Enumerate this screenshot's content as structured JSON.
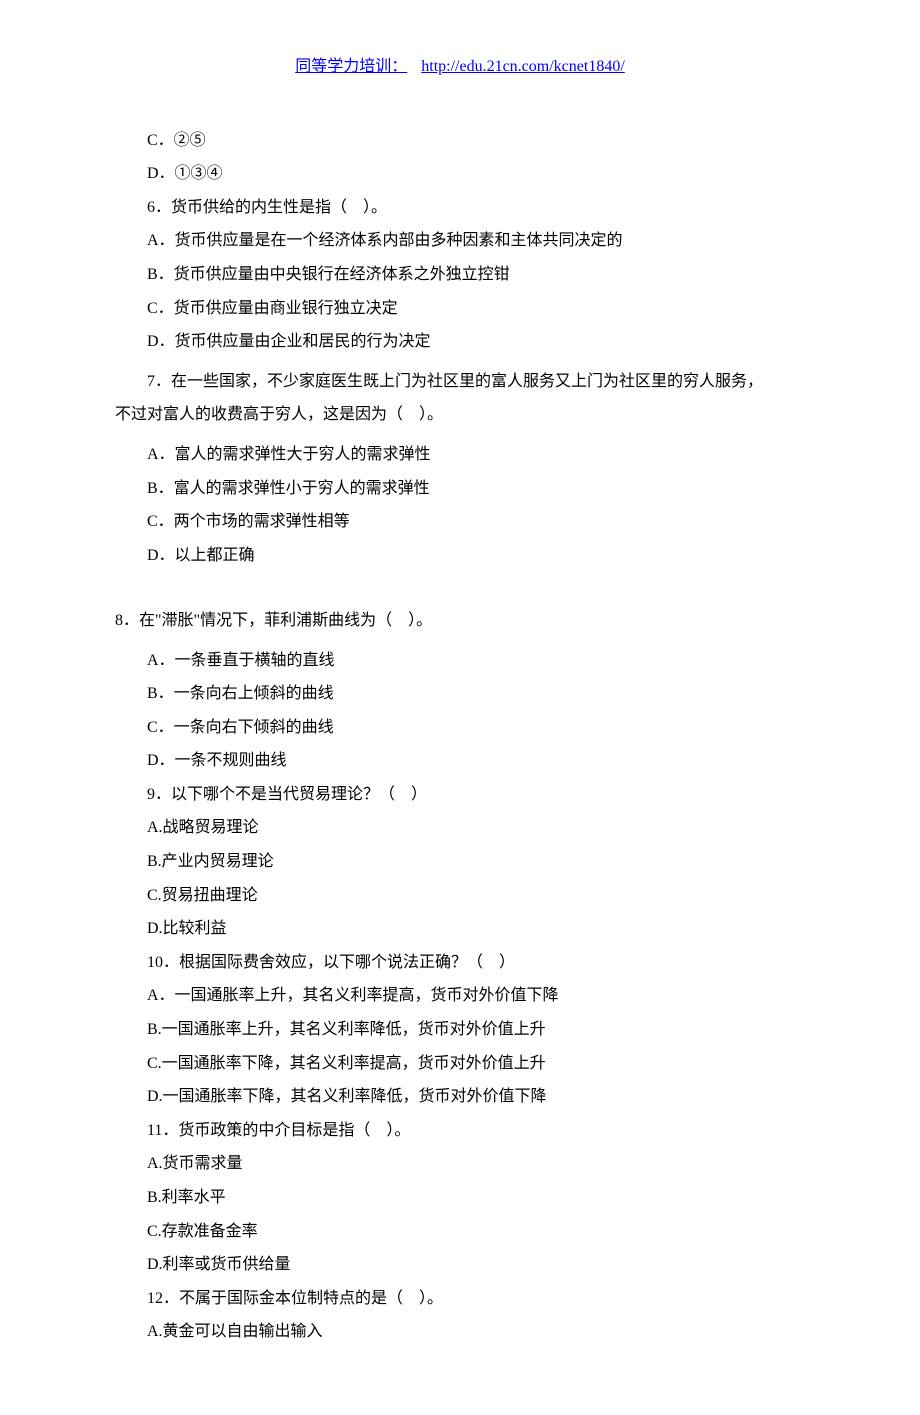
{
  "header": {
    "label": "同等学力培训：",
    "url": "http://edu.21cn.com/kcnet1840/"
  },
  "sections": [
    {
      "indented": true,
      "lines": [
        "C．②⑤",
        "D．①③④",
        "6．货币供给的内生性是指（    ）。",
        "A．货币供应量是在一个经济体系内部由多种因素和主体共同决定的",
        "B．货币供应量由中央银行在经济体系之外独立控钳",
        "C．货币供应量由商业银行独立决定",
        "D．货币供应量由企业和居民的行为决定"
      ]
    },
    {
      "wrapped": true,
      "first": "7．在一些国家，不少家庭医生既上门为社区里的富人服务又上门为社区里的穷人服务，",
      "rest": "不过对富人的收费高于穷人，这是因为（    ）。"
    },
    {
      "indented": true,
      "lines": [
        "A．富人的需求弹性大于穷人的需求弹性",
        "B．富人的需求弹性小于穷人的需求弹性",
        "C．两个市场的需求弹性相等",
        "D．以上都正确"
      ]
    },
    {
      "spacer": true
    },
    {
      "indented": false,
      "lines": [
        "8．在\"滞胀\"情况下，菲利浦斯曲线为（    ）。"
      ]
    },
    {
      "indented": true,
      "lines": [
        "A．一条垂直于横轴的直线",
        "B．一条向右上倾斜的曲线",
        "C．一条向右下倾斜的曲线",
        "D．一条不规则曲线",
        "9．以下哪个不是当代贸易理论？（    ）",
        "A.战略贸易理论",
        "B.产业内贸易理论",
        "C.贸易扭曲理论",
        "D.比较利益",
        "10．根据国际费舍效应，以下哪个说法正确？（    ）",
        "A．一国通胀率上升，其名义利率提高，货币对外价值下降",
        "B.一国通胀率上升，其名义利率降低，货币对外价值上升",
        "C.一国通胀率下降，其名义利率提高，货币对外价值上升",
        "D.一国通胀率下降，其名义利率降低，货币对外价值下降",
        "11．货币政策的中介目标是指（    ）。",
        "A.货币需求量",
        "B.利率水平",
        "C.存款准备金率",
        "D.利率或货币供给量",
        "12．不属于国际金本位制特点的是（    ）。",
        "A.黄金可以自由输出输入"
      ]
    }
  ]
}
